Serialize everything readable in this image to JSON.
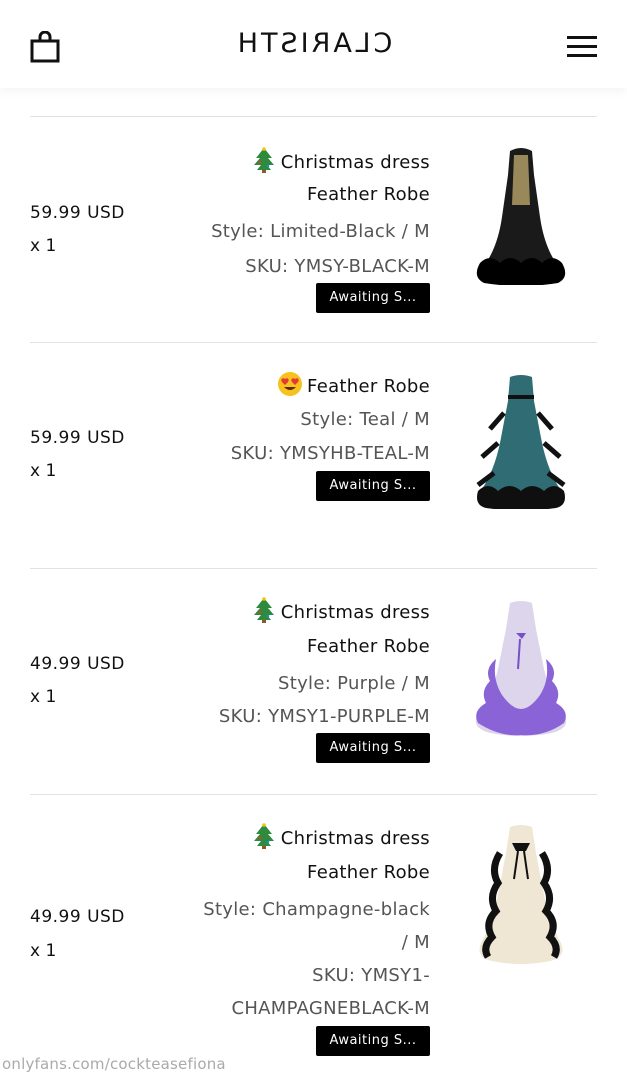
{
  "header": {
    "brand": "CLARISTH"
  },
  "items": [
    {
      "title_line1": "Christmas dress",
      "title_emoji": "christmas-tree-emoji",
      "title_line2": "Feather Robe",
      "style": "Style: Limited-Black / M",
      "sku": "SKU: YMSY-BLACK-M",
      "price": "59.99 USD",
      "qty": "x 1",
      "status": "Awaiting S...",
      "image_color": "#1a1a1a"
    },
    {
      "title_line1": "Feather Robe",
      "title_emoji": "heart-eyes-emoji",
      "style": "Style: Teal / M",
      "sku": "SKU: YMSYHB-TEAL-M",
      "price": "59.99 USD",
      "qty": "x 1",
      "status": "Awaiting S...",
      "image_color": "#2f6c73"
    },
    {
      "title_line1": "Christmas dress",
      "title_emoji": "christmas-tree-emoji",
      "title_line2": "Feather Robe",
      "style": "Style: Purple / M",
      "sku": "SKU: YMSY1-PURPLE-M",
      "price": "49.99 USD",
      "qty": "x 1",
      "status": "Awaiting S...",
      "image_color": "#8a63d6"
    },
    {
      "title_line1": "Christmas dress",
      "title_emoji": "christmas-tree-emoji",
      "title_line2": "Feather Robe",
      "style_line1": "Style: Champagne-black",
      "style_line2": "/ M",
      "sku_line1": "SKU: YMSY1-",
      "sku_line2": "CHAMPAGNEBLACK-M",
      "price": "49.99 USD",
      "qty": "x 1",
      "status": "Awaiting S...",
      "image_color": "#efe6d4"
    }
  ],
  "watermark": "onlyfans.com/cockteasefiona"
}
